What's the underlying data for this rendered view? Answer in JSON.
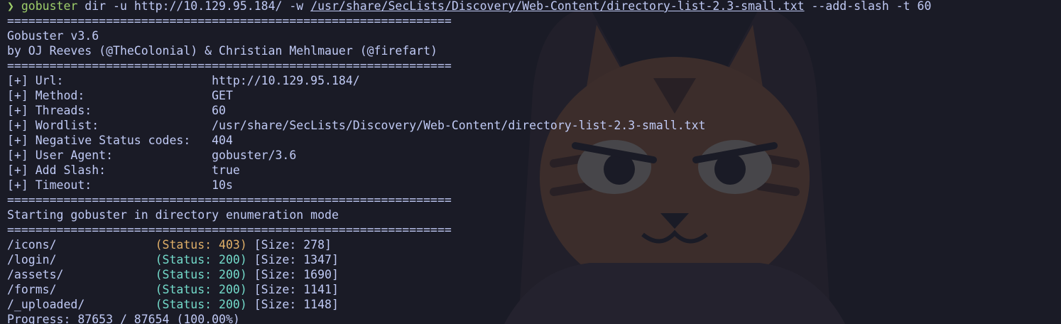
{
  "colors": {
    "background": "#1a1b26",
    "foreground": "#c0caf5",
    "prompt": "#9ece6a",
    "status_403": "#e0af68",
    "status_200": "#73daca"
  },
  "background_image": "cat-wallpaper-icon",
  "prompt": {
    "symbol": "❯",
    "command": "gobuster",
    "args_before": " dir -u http://10.129.95.184/ -w ",
    "wordlist": "/usr/share/SecLists/Discovery/Web-Content/directory-list-2.3-small.txt",
    "args_after": " --add-slash -t 60"
  },
  "separator": "===============================================================",
  "banner": {
    "title": "Gobuster v3.6",
    "authors": "by OJ Reeves (@TheColonial) & Christian Mehlmauer (@firefart)"
  },
  "config": [
    {
      "key": "[+] Url:                     ",
      "value": "http://10.129.95.184/"
    },
    {
      "key": "[+] Method:                  ",
      "value": "GET"
    },
    {
      "key": "[+] Threads:                 ",
      "value": "60"
    },
    {
      "key": "[+] Wordlist:                ",
      "value": "/usr/share/SecLists/Discovery/Web-Content/directory-list-2.3-small.txt"
    },
    {
      "key": "[+] Negative Status codes:   ",
      "value": "404"
    },
    {
      "key": "[+] User Agent:              ",
      "value": "gobuster/3.6"
    },
    {
      "key": "[+] Add Slash:               ",
      "value": "true"
    },
    {
      "key": "[+] Timeout:                 ",
      "value": "10s"
    }
  ],
  "mode_message": "Starting gobuster in directory enumeration mode",
  "results": [
    {
      "path": "/icons/              ",
      "status": "(Status: 403)",
      "code": "403",
      "size": " [Size: 278]"
    },
    {
      "path": "/login/              ",
      "status": "(Status: 200)",
      "code": "200",
      "size": " [Size: 1347]"
    },
    {
      "path": "/assets/             ",
      "status": "(Status: 200)",
      "code": "200",
      "size": " [Size: 1690]"
    },
    {
      "path": "/forms/              ",
      "status": "(Status: 200)",
      "code": "200",
      "size": " [Size: 1141]"
    },
    {
      "path": "/_uploaded/          ",
      "status": "(Status: 200)",
      "code": "200",
      "size": " [Size: 1148]"
    }
  ],
  "progress": "Progress: 87653 / 87654 (100.00%)"
}
